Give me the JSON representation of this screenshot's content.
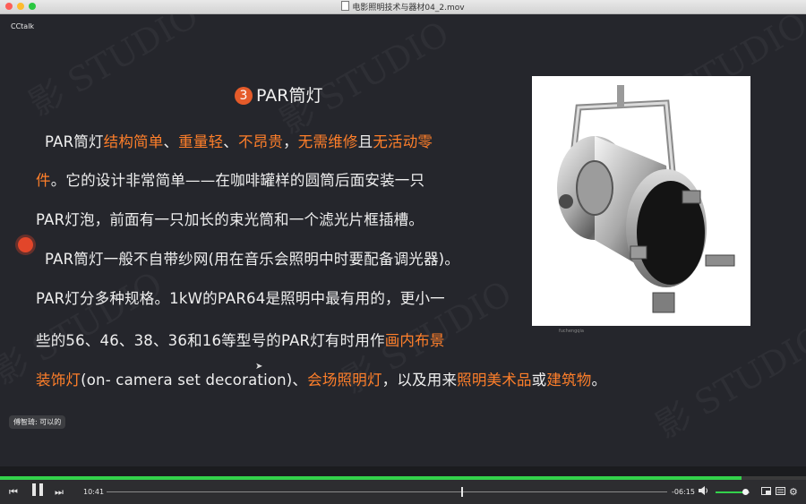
{
  "window": {
    "title": "电影照明技术与器材04_2.mov"
  },
  "video": {
    "brand": "CCtalk",
    "watermark": "影 STUDIO",
    "slide": {
      "number": "3",
      "title": "PAR筒灯",
      "lines": [
        [
          {
            "t": "PAR筒灯"
          },
          {
            "t": "结构简单",
            "hl": true
          },
          {
            "t": "、"
          },
          {
            "t": "重量轻",
            "hl": true
          },
          {
            "t": "、"
          },
          {
            "t": "不昂贵",
            "hl": true
          },
          {
            "t": "，"
          },
          {
            "t": "无需维修",
            "hl": true
          },
          {
            "t": "且"
          },
          {
            "t": "无活动零",
            "hl": true
          }
        ],
        [
          {
            "t": "件",
            "hl": true
          },
          {
            "t": "。它的设计非常简单——在咖啡罐样的圆筒后面安装一只"
          }
        ],
        [
          {
            "t": "PAR灯泡，前面有一只加长的束光筒和一个滤光片框插槽。"
          }
        ],
        [
          {
            "t": "PAR筒灯一般不自带纱网(用在音乐会照明中时要配备调光器)。"
          }
        ],
        [
          {
            "t": "PAR灯分多种规格。1kW的PAR64是照明中最有用的，更小一"
          }
        ],
        [
          {
            "t": "些的56、46、38、36和16等型号的PAR灯有时用作"
          },
          {
            "t": "画内布景",
            "hl": true
          }
        ],
        [
          {
            "t": "装饰灯",
            "hl": true
          },
          {
            "t": "(on- camera set decoration)、"
          },
          {
            "t": "会场照明灯",
            "hl": true
          },
          {
            "t": "，以及用来"
          },
          {
            "t": "照明美术品",
            "hl": true
          },
          {
            "t": "或"
          },
          {
            "t": "建筑物",
            "hl": true
          },
          {
            "t": "。"
          }
        ]
      ],
      "image_caption": "fuchengqia"
    },
    "chat_message": "傅智琦: 可以的"
  },
  "player": {
    "elapsed": "10:41",
    "remaining": "-06:15",
    "playback_progress": 0.632,
    "buffered_progress": 0.92,
    "volume": 0.88,
    "icons": [
      "rewind-icon",
      "pause-icon",
      "fast-forward-icon",
      "volume-icon",
      "pip-icon",
      "playlist-icon",
      "settings-icon"
    ]
  },
  "colors": {
    "highlight": "#ff7f2a",
    "accent_green": "#33d24b",
    "slide_bg": "#25262c"
  }
}
